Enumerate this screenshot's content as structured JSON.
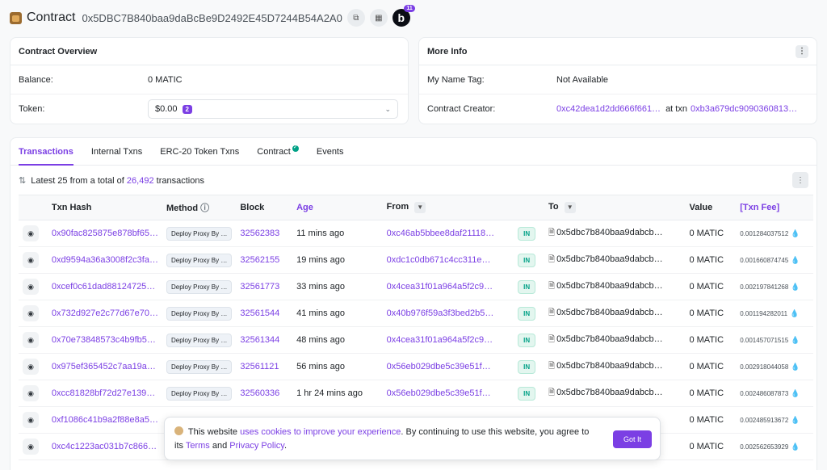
{
  "header": {
    "title": "Contract",
    "address": "0x5DBC7B840baa9daBcBe9D2492E45D7244B54A2A0",
    "badge_letter": "b",
    "badge_count": "11"
  },
  "overview": {
    "title": "Contract Overview",
    "balance_label": "Balance:",
    "balance_value": "0 MATIC",
    "token_label": "Token:",
    "token_value": "$0.00",
    "token_count": "2"
  },
  "more_info": {
    "title": "More Info",
    "name_tag_label": "My Name Tag:",
    "name_tag_value": "Not Available",
    "creator_label": "Contract Creator:",
    "creator_address": "0xc42dea1d2dd666f661…",
    "at_txn_label": "at txn",
    "creator_txn": "0xb3a679dc9090360813…"
  },
  "tabs": [
    "Transactions",
    "Internal Txns",
    "ERC-20 Token Txns",
    "Contract",
    "Events"
  ],
  "summary": {
    "prefix": "Latest 25 from a total of",
    "total": "26,492",
    "suffix": "transactions"
  },
  "columns": {
    "hash": "Txn Hash",
    "method": "Method",
    "block": "Block",
    "age": "Age",
    "from": "From",
    "to": "To",
    "value": "Value",
    "fee": "[Txn Fee]"
  },
  "rows": [
    {
      "hash": "0x90fac825875e878bf65…",
      "method": "Deploy Proxy By …",
      "block": "32562383",
      "age": "11 mins ago",
      "from": "0xc46ab5bbee8daf21118…",
      "dir": "IN",
      "to": "0x5dbc7b840baa9dabcb…",
      "value": "0 MATIC",
      "fee": "0.001284037512"
    },
    {
      "hash": "0xd9594a36a3008f2c3fa…",
      "method": "Deploy Proxy By …",
      "block": "32562155",
      "age": "19 mins ago",
      "from": "0xdc1c0db671c4cc311e…",
      "dir": "IN",
      "to": "0x5dbc7b840baa9dabcb…",
      "value": "0 MATIC",
      "fee": "0.001660874745"
    },
    {
      "hash": "0xcef0c61dad88124725…",
      "method": "Deploy Proxy By …",
      "block": "32561773",
      "age": "33 mins ago",
      "from": "0x4cea31f01a964a5f2c9…",
      "dir": "IN",
      "to": "0x5dbc7b840baa9dabcb…",
      "value": "0 MATIC",
      "fee": "0.002197841268"
    },
    {
      "hash": "0x732d927e2c77d67e70…",
      "method": "Deploy Proxy By …",
      "block": "32561544",
      "age": "41 mins ago",
      "from": "0x40b976f59a3f3bed2b5…",
      "dir": "IN",
      "to": "0x5dbc7b840baa9dabcb…",
      "value": "0 MATIC",
      "fee": "0.001194282011"
    },
    {
      "hash": "0x70e73848573c4b9fb5…",
      "method": "Deploy Proxy By …",
      "block": "32561344",
      "age": "48 mins ago",
      "from": "0x4cea31f01a964a5f2c9…",
      "dir": "IN",
      "to": "0x5dbc7b840baa9dabcb…",
      "value": "0 MATIC",
      "fee": "0.001457071515"
    },
    {
      "hash": "0x975ef365452c7aa19a…",
      "method": "Deploy Proxy By …",
      "block": "32561121",
      "age": "56 mins ago",
      "from": "0x56eb029dbe5c39e51f…",
      "dir": "IN",
      "to": "0x5dbc7b840baa9dabcb…",
      "value": "0 MATIC",
      "fee": "0.002918044058"
    },
    {
      "hash": "0xcc81828bf72d27e139…",
      "method": "Deploy Proxy By …",
      "block": "32560336",
      "age": "1 hr 24 mins ago",
      "from": "0x56eb029dbe5c39e51f…",
      "dir": "IN",
      "to": "0x5dbc7b840baa9dabcb…",
      "value": "0 MATIC",
      "fee": "0.002486087873"
    },
    {
      "hash": "0xf1086c41b9a2f88e8a5…",
      "method": "",
      "block": "",
      "age": "",
      "from": "",
      "dir": "",
      "to": "",
      "value": "0 MATIC",
      "fee": "0.002485913672"
    },
    {
      "hash": "0xc4c1223ac031b7c866…",
      "method": "",
      "block": "",
      "age": "",
      "from": "",
      "dir": "",
      "to": "",
      "value": "0 MATIC",
      "fee": "0.002562653929"
    }
  ],
  "cookie": {
    "text_1": "This website",
    "link_1": "uses cookies to improve your experience",
    "text_2": ". By continuing to use this website, you agree to its",
    "link_2": "Terms",
    "text_3": "and",
    "link_3": "Privacy Policy",
    "text_4": ".",
    "button": "Got It"
  },
  "colors": {
    "accent": "#7b3fe4",
    "success": "#00a186"
  }
}
